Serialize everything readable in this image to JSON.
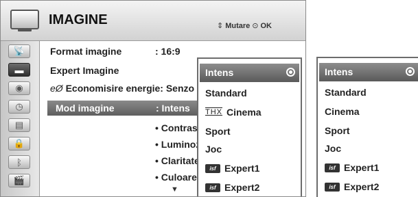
{
  "header": {
    "title": "IMAGINE",
    "hint_move": "Mutare",
    "hint_ok": "OK",
    "hint_move_icon": "dpad-icon",
    "hint_ok_icon": "ok-button-icon"
  },
  "sidebar": {
    "items": [
      {
        "icon": "satellite-icon",
        "glyph": "📡"
      },
      {
        "icon": "tv-picture-icon",
        "glyph": "▬"
      },
      {
        "icon": "speaker-icon",
        "glyph": "◉"
      },
      {
        "icon": "clock-icon",
        "glyph": "◷"
      },
      {
        "icon": "calendar-icon",
        "glyph": "▤"
      },
      {
        "icon": "lock-icon",
        "glyph": "🔒"
      },
      {
        "icon": "bluetooth-icon",
        "glyph": "ᛒ"
      },
      {
        "icon": "media-icon",
        "glyph": "🎬"
      }
    ]
  },
  "menu": {
    "format_label": "Format imagine",
    "format_value": ": 16:9",
    "expert_label": "Expert Imagine",
    "energy_label": "Economisire energie: Senzo",
    "energy_icon": "eco-icon",
    "mode_label": "Mod imagine",
    "mode_value": ": Intens",
    "sub_items": [
      "• Contrast",
      "• Luminoz",
      "• Claritate",
      "• Culoare"
    ]
  },
  "dropdown1": {
    "selected": "Intens",
    "items": [
      "Standard",
      "Cinema",
      "Sport",
      "Joc",
      "Expert1",
      "Expert2"
    ],
    "thx_text": "THX",
    "isf_text": "isf"
  },
  "dropdown2": {
    "selected": "Intens",
    "items": [
      "Standard",
      "Cinema",
      "Sport",
      "Joc",
      "Expert1",
      "Expert2"
    ],
    "isf_text": "isf"
  }
}
